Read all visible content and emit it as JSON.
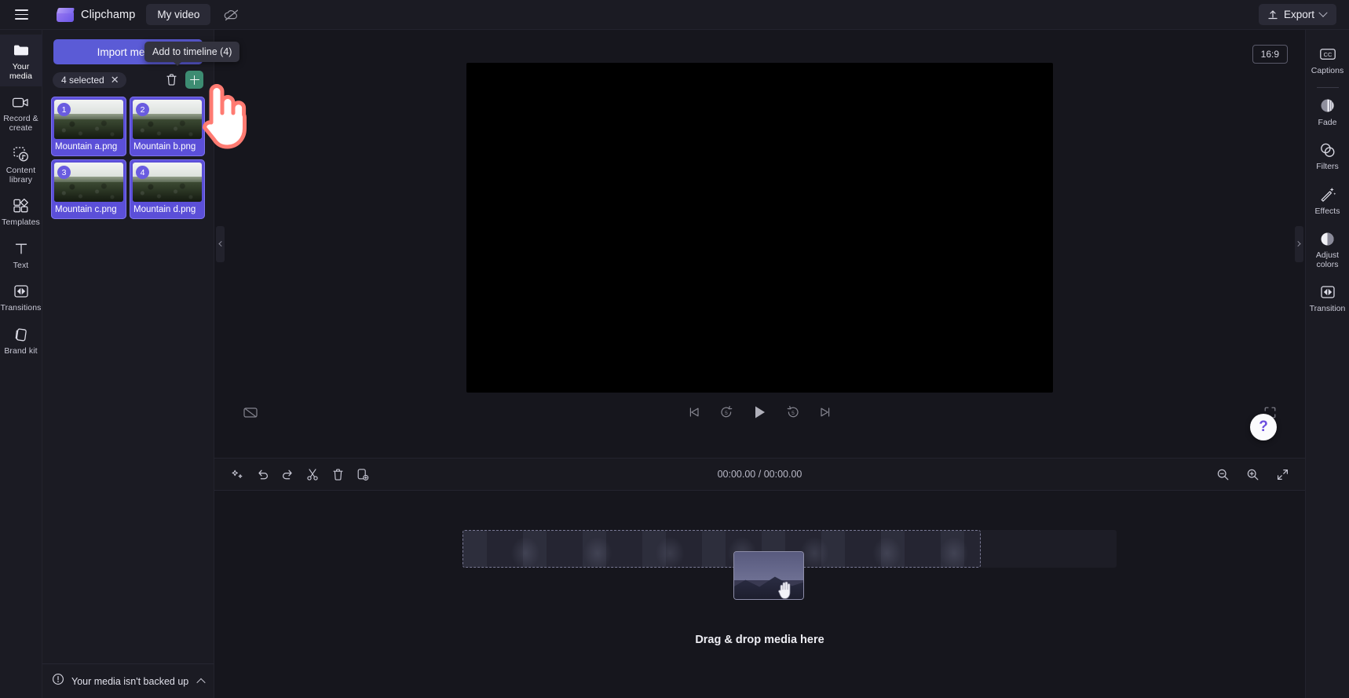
{
  "topbar": {
    "menu_icon": "hamburger-icon",
    "brand": "Clipchamp",
    "project_tab": "My video",
    "cloud_icon": "cloud-off-icon",
    "export_label": "Export",
    "export_icon": "upload-icon"
  },
  "left_rail": {
    "items": [
      {
        "label": "Your media",
        "icon": "folder-icon",
        "active": true
      },
      {
        "label": "Record & create",
        "icon": "video-camera-icon",
        "active": false
      },
      {
        "label": "Content library",
        "icon": "content-library-icon",
        "active": false
      },
      {
        "label": "Templates",
        "icon": "templates-icon",
        "active": false
      },
      {
        "label": "Text",
        "icon": "text-icon",
        "active": false
      },
      {
        "label": "Transitions",
        "icon": "transitions-icon",
        "active": false
      },
      {
        "label": "Brand kit",
        "icon": "brand-kit-icon",
        "active": false
      }
    ]
  },
  "media_panel": {
    "import_button": "Import media",
    "tooltip": "Add to timeline (4)",
    "selection_chip": "4 selected",
    "clear_selection_icon": "close-icon",
    "delete_icon": "trash-icon",
    "add_icon": "plus-icon",
    "add_button_color": "#3d8c72",
    "items": [
      {
        "index": "1",
        "name": "Mountain a.png"
      },
      {
        "index": "2",
        "name": "Mountain b.png"
      },
      {
        "index": "3",
        "name": "Mountain c.png"
      },
      {
        "index": "4",
        "name": "Mountain d.png"
      }
    ],
    "backup_notice": "Your media isn't backed up",
    "backup_icon": "info-circle-icon"
  },
  "preview": {
    "aspect_ratio": "16:9",
    "controls": {
      "closed_captions_icon": "cc-off-icon",
      "skip_start_icon": "skip-to-start-icon",
      "back5_icon": "rewind-5-icon",
      "play_icon": "play-icon",
      "forward5_icon": "forward-5-icon",
      "skip_end_icon": "skip-to-end-icon",
      "fullscreen_icon": "fullscreen-icon"
    },
    "help_label": "?"
  },
  "timeline": {
    "tools": [
      {
        "icon": "magic-wand-icon",
        "name": "auto-compose"
      },
      {
        "icon": "undo-icon",
        "name": "undo"
      },
      {
        "icon": "redo-icon",
        "name": "redo"
      },
      {
        "icon": "scissors-icon",
        "name": "split"
      },
      {
        "icon": "trash-icon",
        "name": "delete"
      },
      {
        "icon": "duplicate-icon",
        "name": "duplicate"
      }
    ],
    "current_time": "00:00.00",
    "total_time": "00:00.00",
    "time_separator": "/",
    "zoom_out_icon": "zoom-out-icon",
    "zoom_in_icon": "zoom-in-icon",
    "fit_icon": "fit-to-screen-icon",
    "drop_hint": "Drag & drop media here"
  },
  "right_rail": {
    "items": [
      {
        "label": "Captions",
        "icon": "cc-icon"
      },
      {
        "label": "Fade",
        "icon": "fade-icon"
      },
      {
        "label": "Filters",
        "icon": "filters-icon"
      },
      {
        "label": "Effects",
        "icon": "effects-icon"
      },
      {
        "label": "Adjust colors",
        "icon": "adjust-colors-icon"
      },
      {
        "label": "Transition",
        "icon": "transition-icon"
      }
    ]
  },
  "colors": {
    "accent_purple": "#5b5bd6",
    "selected_thumb": "#5b4fd8",
    "add_green": "#3d8c72",
    "bg_dark": "#16161d",
    "panel": "#1b1b23"
  }
}
